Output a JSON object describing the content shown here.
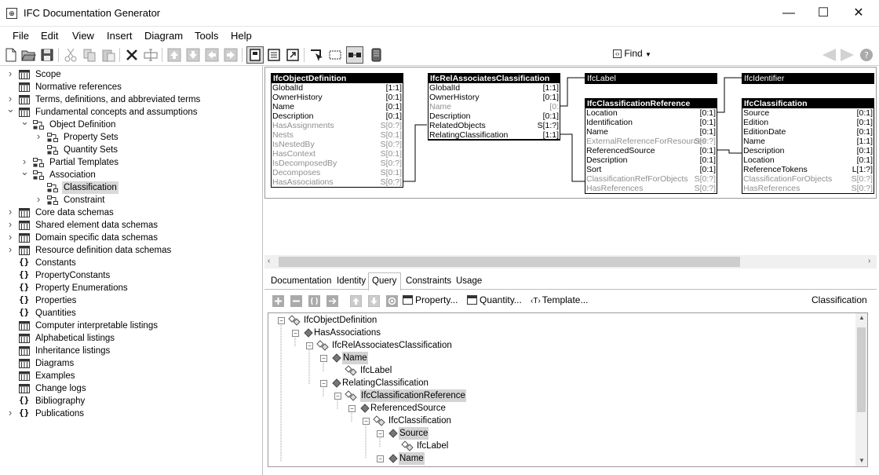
{
  "window": {
    "title": "IFC Documentation Generator",
    "minimize": "—",
    "maximize": "☐",
    "close": "✕"
  },
  "menu": [
    "File",
    "Edit",
    "View",
    "Insert",
    "Diagram",
    "Tools",
    "Help"
  ],
  "toolbar": {
    "find_label": "Find",
    "find_value": ""
  },
  "lefttree": {
    "items": [
      {
        "label": "Scope",
        "chev": "›",
        "icon": "book-icon"
      },
      {
        "label": "Normative references",
        "chev": "",
        "icon": "book-icon"
      },
      {
        "label": "Terms, definitions, and abbreviated terms",
        "chev": "›",
        "icon": "book-icon"
      },
      {
        "label": "Fundamental concepts and assumptions",
        "chev": "⌄",
        "icon": "book-icon"
      },
      {
        "label": "Object Definition",
        "chev": "⌄",
        "icon": "concept-icon"
      },
      {
        "label": "Property Sets",
        "chev": "›",
        "icon": "concept-icon"
      },
      {
        "label": "Quantity Sets",
        "chev": "",
        "icon": "concept-icon"
      },
      {
        "label": "Partial Templates",
        "chev": "›",
        "icon": "concept-icon"
      },
      {
        "label": "Association",
        "chev": "⌄",
        "icon": "concept-icon"
      },
      {
        "label": "Classification",
        "chev": "",
        "icon": "concept-icon"
      },
      {
        "label": "Constraint",
        "chev": "›",
        "icon": "concept-icon"
      },
      {
        "label": "Core data schemas",
        "chev": "›",
        "icon": "book-icon"
      },
      {
        "label": "Shared element data schemas",
        "chev": "›",
        "icon": "book-icon"
      },
      {
        "label": "Domain specific data schemas",
        "chev": "›",
        "icon": "book-icon"
      },
      {
        "label": "Resource definition data schemas",
        "chev": "›",
        "icon": "book-icon"
      },
      {
        "label": "Constants",
        "chev": "",
        "icon": "braces-icon"
      },
      {
        "label": "PropertyConstants",
        "chev": "",
        "icon": "braces-icon"
      },
      {
        "label": "Property Enumerations",
        "chev": "",
        "icon": "braces-icon"
      },
      {
        "label": "Properties",
        "chev": "",
        "icon": "braces-icon"
      },
      {
        "label": "Quantities",
        "chev": "",
        "icon": "braces-icon"
      },
      {
        "label": "Computer interpretable listings",
        "chev": "",
        "icon": "book-icon"
      },
      {
        "label": "Alphabetical listings",
        "chev": "",
        "icon": "book-icon"
      },
      {
        "label": "Inheritance listings",
        "chev": "",
        "icon": "book-icon"
      },
      {
        "label": "Diagrams",
        "chev": "",
        "icon": "book-icon"
      },
      {
        "label": "Examples",
        "chev": "",
        "icon": "book-icon"
      },
      {
        "label": "Change logs",
        "chev": "",
        "icon": "book-icon"
      },
      {
        "label": "Bibliography",
        "chev": "",
        "icon": "braces-icon"
      },
      {
        "label": "Publications",
        "chev": "›",
        "icon": "braces-icon"
      }
    ]
  },
  "diagram": {
    "obj_def": {
      "title": "IfcObjectDefinition",
      "attrs": [
        [
          "GlobalId",
          "[1:1]",
          ""
        ],
        [
          "OwnerHistory",
          "[0:1]",
          ""
        ],
        [
          "Name",
          "[0:1]",
          ""
        ],
        [
          "Description",
          "[0:1]",
          ""
        ],
        [
          "HasAssignments",
          "S[0:?]",
          "g"
        ],
        [
          "Nests",
          "S[0:1]",
          "g"
        ],
        [
          "IsNestedBy",
          "S[0:?]",
          "g"
        ],
        [
          "HasContext",
          "S[0:1]",
          "g"
        ],
        [
          "IsDecomposedBy",
          "S[0:?]",
          "g"
        ],
        [
          "Decomposes",
          "S[0:1]",
          "g"
        ],
        [
          "HasAssociations",
          "S[0:?]",
          "g"
        ]
      ]
    },
    "rel_assoc": {
      "title": "IfcRelAssociatesClassification",
      "attrs": [
        [
          "GlobalId",
          "[1:1]",
          ""
        ],
        [
          "OwnerHistory",
          "[0:1]",
          ""
        ],
        [
          "Name",
          "[0:",
          "g"
        ],
        [
          "Description",
          "[0:1]",
          ""
        ],
        [
          "RelatedObjects",
          "S[1:?]",
          ""
        ],
        [
          "RelatingClassification",
          "[1:1]",
          "b"
        ]
      ]
    },
    "label": {
      "title": "IfcLabel"
    },
    "identifier": {
      "title": "IfcIdentifier"
    },
    "class_ref": {
      "title": "IfcClassificationReference",
      "attrs": [
        [
          "Location",
          "[0:1]",
          ""
        ],
        [
          "Identification",
          "[0:1]",
          ""
        ],
        [
          "Name",
          "[0:1]",
          ""
        ],
        [
          "ExternalReferenceForResources",
          "S[0:?]",
          "g"
        ],
        [
          "ReferencedSource",
          "[0:1]",
          ""
        ],
        [
          "Description",
          "[0:1]",
          ""
        ],
        [
          "Sort",
          "[0:1]",
          ""
        ],
        [
          "ClassificationRefForObjects",
          "S[0:?]",
          "g"
        ],
        [
          "HasReferences",
          "S[0:?]",
          "g"
        ]
      ]
    },
    "classification": {
      "title": "IfcClassification",
      "attrs": [
        [
          "Source",
          "[0:1]",
          ""
        ],
        [
          "Edition",
          "[0:1]",
          ""
        ],
        [
          "EditionDate",
          "[0:1]",
          ""
        ],
        [
          "Name",
          "[1:1]",
          ""
        ],
        [
          "Description",
          "[0:1]",
          ""
        ],
        [
          "Location",
          "[0:1]",
          ""
        ],
        [
          "ReferenceTokens",
          "L[1:?]",
          ""
        ],
        [
          "ClassificationForObjects",
          "S[0:?]",
          "g"
        ],
        [
          "HasReferences",
          "S[0:?]",
          "g"
        ]
      ]
    }
  },
  "tabs": [
    "Documentation",
    "Identity",
    "Query",
    "Constraints",
    "Usage"
  ],
  "query_toolbar": {
    "property": "Property...",
    "quantity": "Quantity...",
    "template": "Template...",
    "context": "Classification"
  },
  "query_tree": [
    {
      "label": "IfcObjectDefinition",
      "hl": false,
      "icon": "entity-icon"
    },
    {
      "label": "HasAssociations",
      "hl": false,
      "icon": "attribute-icon"
    },
    {
      "label": "IfcRelAssociatesClassification",
      "hl": false,
      "icon": "entity-icon"
    },
    {
      "label": "Name",
      "hl": true,
      "icon": "attribute-icon"
    },
    {
      "label": "IfcLabel",
      "hl": false,
      "icon": "entity-icon"
    },
    {
      "label": "RelatingClassification",
      "hl": false,
      "icon": "attribute-icon"
    },
    {
      "label": "IfcClassificationReference",
      "hl": true,
      "icon": "entity-icon"
    },
    {
      "label": "ReferencedSource",
      "hl": false,
      "icon": "attribute-icon"
    },
    {
      "label": "IfcClassification",
      "hl": false,
      "icon": "entity-icon"
    },
    {
      "label": "Source",
      "hl": true,
      "icon": "attribute-icon"
    },
    {
      "label": "IfcLabel",
      "hl": false,
      "icon": "entity-icon"
    },
    {
      "label": "Name",
      "hl": true,
      "icon": "attribute-icon"
    }
  ]
}
